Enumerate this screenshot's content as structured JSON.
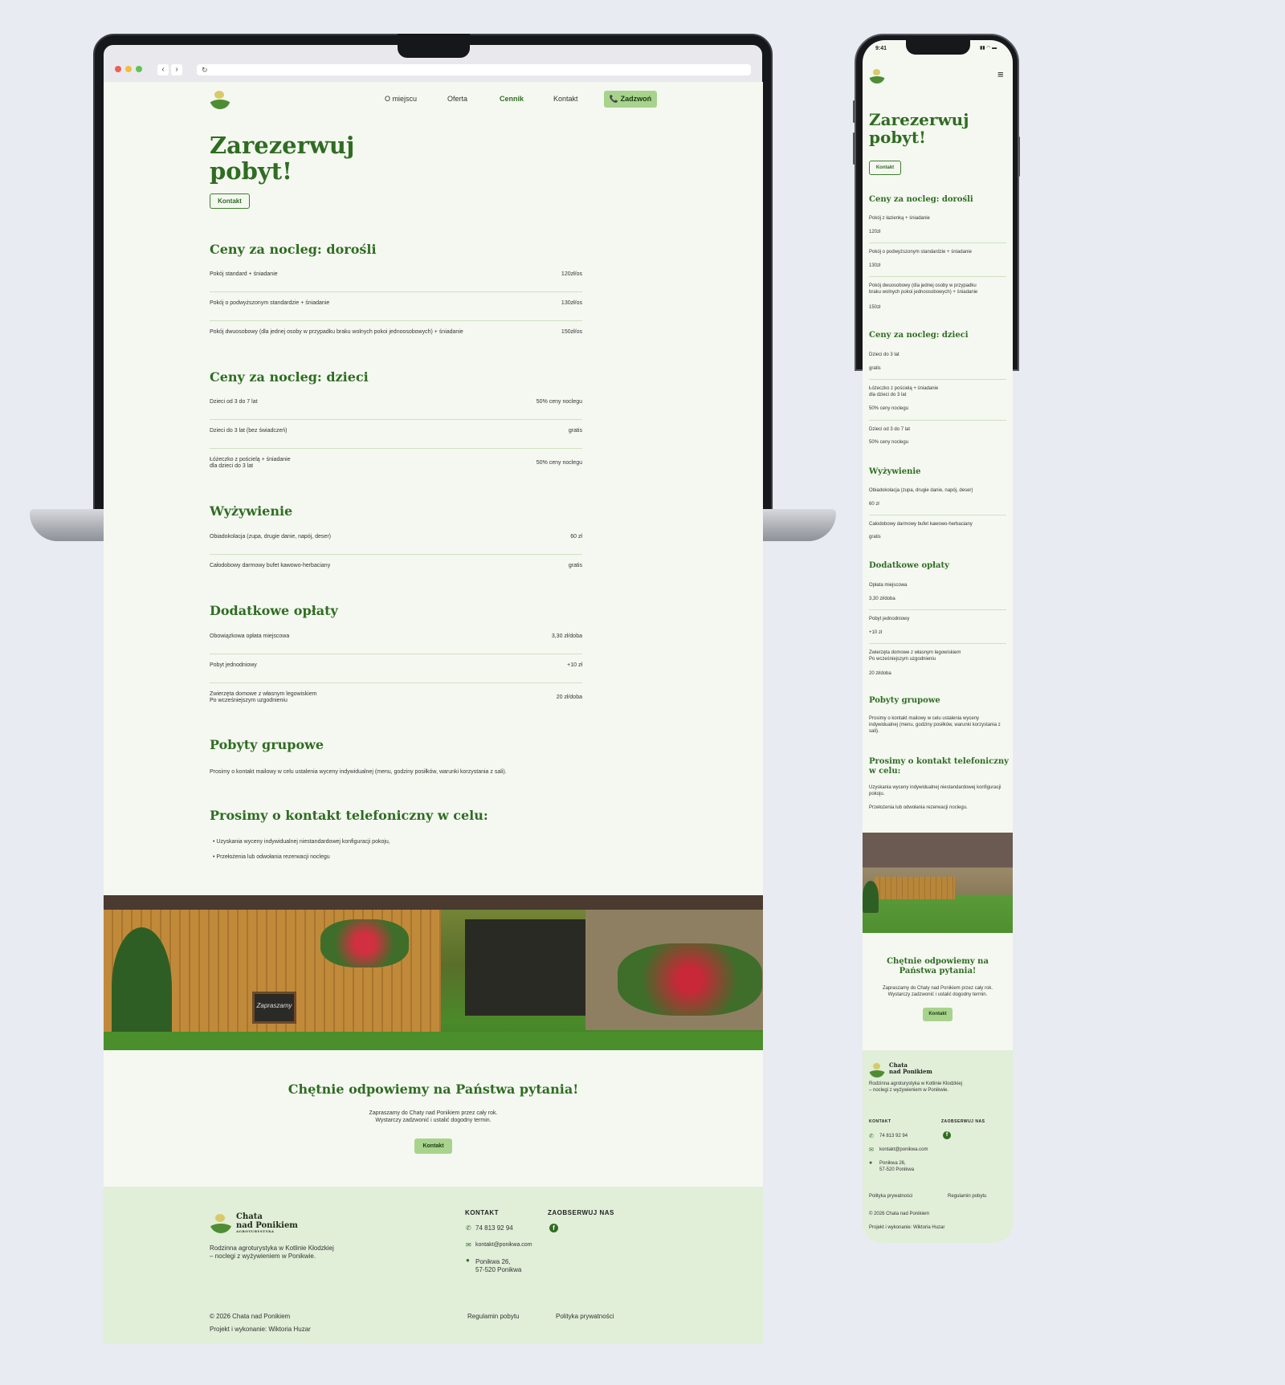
{
  "browser": {
    "back_glyph": "‹",
    "forward_glyph": "›",
    "reload_glyph": "↻"
  },
  "desktop": {
    "nav": {
      "items": [
        "O miejscu",
        "Oferta",
        "Cennik",
        "Kontakt"
      ],
      "active": "Cennik",
      "call_label": "📞 Zadzwoń"
    },
    "hero": {
      "title_line1": "Zarezerwuj",
      "title_line2": "pobyt!",
      "button": "Kontakt"
    },
    "adults": {
      "title": "Ceny za nocleg: dorośli",
      "rows": [
        {
          "label": "Pokój standard + śniadanie",
          "price": "120zł/os"
        },
        {
          "label": "Pokój o podwyższonym standardzie + śniadanie",
          "price": "130zł/os"
        },
        {
          "label": "Pokój dwuosobowy (dla jednej osoby w przypadku braku wolnych pokoi jednoosobowych) + śniadanie",
          "price": "150zł/os"
        }
      ]
    },
    "kids": {
      "title": "Ceny za nocleg: dzieci",
      "rows": [
        {
          "label": "Dzieci od 3 do 7 lat",
          "price": "50% ceny noclegu"
        },
        {
          "label": "Dzieci do 3 lat (bez świadczeń)",
          "price": "gratis"
        },
        {
          "label": "Łóżeczko z pościelą + śniadanie\ndla dzieci do 3 lat",
          "price": "50% ceny noclegu"
        }
      ]
    },
    "food": {
      "title": "Wyżywienie",
      "rows": [
        {
          "label": "Obiadokolacja (zupa, drugie danie, napój, deser)",
          "price": "60 zł"
        },
        {
          "label": "Całodobowy darmowy bufet kawowo-herbaciany",
          "price": "gratis"
        }
      ]
    },
    "extra": {
      "title": "Dodatkowe opłaty",
      "rows": [
        {
          "label": "Obowiązkowa opłata miejscowa",
          "price": "3,30 zł/doba"
        },
        {
          "label": "Pobyt jednodniowy",
          "price": "+10 zł"
        },
        {
          "label": "Zwierzęta domowe z własnym legowiskiem\nPo wcześniejszym uzgodnieniu",
          "price": "20 zł/doba"
        }
      ]
    },
    "group": {
      "title": "Pobyty grupowe",
      "text": "Prosimy o kontakt mailowy w celu ustalenia wyceny indywidualnej (menu, godziny posiłków, warunki korzystania z sali)."
    },
    "phone_contact": {
      "title": "Prosimy o kontakt telefoniczny w celu:",
      "items": [
        "Uzyskania wyceny indywidualnej niestandardowej konfiguracji pokoju,",
        "Przełożenia lub odwołania rezerwacji noclegu"
      ]
    },
    "photo_sign": "Zapraszamy",
    "cta": {
      "title": "Chętnie odpowiemy na Państwa pytania!",
      "line1": "Zapraszamy do Chaty nad Ponikiem przez cały rok.",
      "line2": "Wystarczy zadzwonić i ustalić dogodny termin.",
      "button": "Kontakt"
    },
    "footer": {
      "brand_line1": "Chata",
      "brand_line2": "nad Ponikiem",
      "brand_sub": "AGROTURYSTYKA",
      "desc1": "Rodzinna agroturystyka w Kotlinie Kłodzkiej",
      "desc2": "– noclegi z wyżywieniem w Ponikwie.",
      "contact_head": "KONTAKT",
      "phone": "74 813 92 94",
      "email": "kontakt@ponikwa.com",
      "addr1": "Ponikwa 26,",
      "addr2": "57-520 Ponikwa",
      "follow_head": "ZAOBSERWUJ NAS",
      "facebook_glyph": "f",
      "copyright": "© 2026 Chata nad Ponikiem",
      "credits": "Projekt i wykonanie: Wiktoria Huzar",
      "terms": "Regulamin pobytu",
      "privacy": "Polityka prywatności"
    }
  },
  "mobile": {
    "status_time": "9:41",
    "status_icons": "▮▮ ◠ ▬",
    "menu_glyph": "≡",
    "hero": {
      "title_line1": "Zarezerwuj",
      "title_line2": "pobyt!",
      "button": "Kontakt"
    },
    "adults": {
      "title": "Ceny za nocleg: dorośli",
      "rows": [
        {
          "label": "Pokój z łazienką + śniadanie",
          "price": "120zł"
        },
        {
          "label": "Pokój o podwyższonym standardzie + śniadanie",
          "price": "130zł"
        },
        {
          "label": "Pokój dwuosobowy (dla jednej osoby w przypadku\nbraku wolnych pokoi jednoosobowych) + śniadanie",
          "price": "150zł"
        }
      ]
    },
    "kids": {
      "title": "Ceny za nocleg: dzieci",
      "rows": [
        {
          "label": "Dzieci do 3 lat",
          "price": "gratis"
        },
        {
          "label": "Łóżeczko z pościelą + śniadanie\ndla dzieci do 3 lat",
          "price": "50% ceny noclegu"
        },
        {
          "label": "Dzieci od 3 do 7 lat",
          "price": "50% ceny noclegu"
        }
      ]
    },
    "food": {
      "title": "Wyżywienie",
      "rows": [
        {
          "label": "Obiadokolacja (zupa, drugie danie, napój, deser)",
          "price": "60 zł"
        },
        {
          "label": "Całodobowy darmowy bufet kawowo-herbaciany",
          "price": "gratis"
        }
      ]
    },
    "extra": {
      "title": "Dodatkowe opłaty",
      "rows": [
        {
          "label": "Opłata miejscowa",
          "price": "3,30 zł/doba"
        },
        {
          "label": "Pobyt jednodniowy",
          "price": "+10 zł"
        },
        {
          "label": "Zwierzęta domowe z własnym legowiskiem\nPo wcześniejszym uzgodnieniu",
          "price": "20 zł/doba"
        }
      ]
    },
    "group": {
      "title": "Pobyty grupowe",
      "text": "Prosimy o kontakt mailowy w celu ustalenia wyceny indywidualnej (menu, godziny posiłków, warunki korzystania z sali)."
    },
    "phone_contact": {
      "title_line1": "Prosimy o kontakt telefoniczny",
      "title_line2": "w celu:",
      "item1": "Uzyskania wyceny indywidualnej niestandardowej konfiguracji pokoju.",
      "item2": "Przełożenia lub odwołania rezerwacji noclegu."
    },
    "cta": {
      "title_line1": "Chętnie odpowiemy na",
      "title_line2": "Państwa pytania!",
      "line1": "Zapraszamy do Chaty nad Ponikiem przez cały rok.",
      "line2": "Wystarczy zadzwonić i ustalić dogodny termin.",
      "button": "Kontakt"
    },
    "footer": {
      "brand_line1": "Chata",
      "brand_line2": "nad Ponikiem",
      "desc1": "Rodzinna agroturystyka w Kotlinie Kłodzkiej",
      "desc2": "– noclegi z wyżywieniem w Ponikwie.",
      "contact_head": "KONTAKT",
      "follow_head": "ZAOBSERWUJ NAS",
      "facebook_glyph": "f",
      "phone": "74 813 92 94",
      "email": "kontakt@ponikwa.com",
      "addr1": "Ponikwa 26,",
      "addr2": "57-520 Ponikwa",
      "privacy": "Polityka prywatności",
      "terms": "Regulamin pobytu",
      "copyright": "© 2026 Chata nad Ponikiem",
      "credits": "Projekt i wykonanie: Wiktoria Huzar"
    }
  },
  "colors": {
    "accent": "#2f6d22",
    "button_green": "#a7d38d",
    "page_bg": "#f5f8f1",
    "footer_bg": "#e1eed8",
    "backdrop": "#e8ebf2"
  },
  "icons": [
    "phone-icon",
    "mail-icon",
    "pin-icon",
    "facebook-icon",
    "hamburger-icon",
    "reload-icon"
  ]
}
